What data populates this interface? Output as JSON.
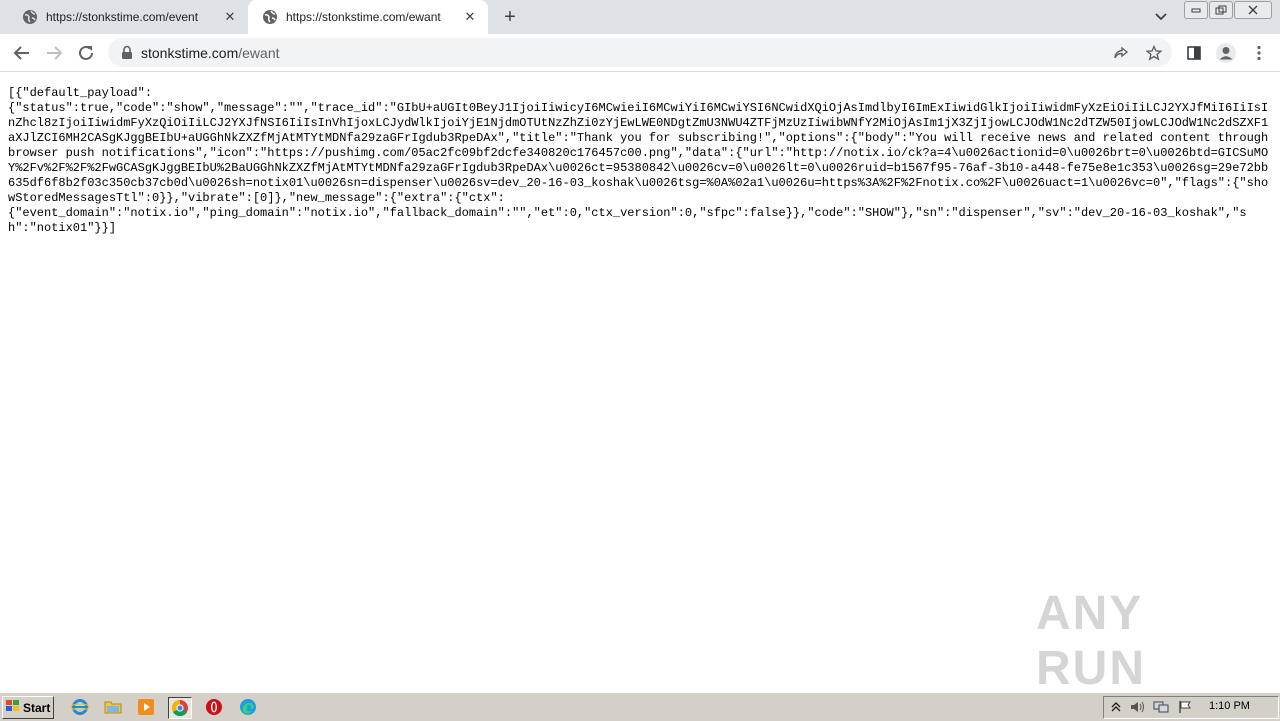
{
  "browser": {
    "tabs": [
      {
        "title": "https://stonkstime.com/event",
        "active": false
      },
      {
        "title": "https://stonkstime.com/ewant",
        "active": true
      }
    ],
    "address_bar": {
      "host": "stonkstime.com",
      "path": "/ewant"
    },
    "icons": {
      "favicon": "globe-icon",
      "close": "close-icon",
      "new_tab": "plus-icon",
      "tab_search": "chevron-down-icon",
      "back": "arrow-left-icon",
      "forward": "arrow-right-icon",
      "reload": "reload-icon",
      "lock": "lock-icon",
      "share": "share-icon",
      "bookmark": "star-icon",
      "side_panel": "side-panel-icon",
      "profile": "profile-icon",
      "menu": "kebab-menu-icon"
    }
  },
  "page": {
    "json_body": "[{\"default_payload\":\n{\"status\":true,\"code\":\"show\",\"message\":\"\",\"trace_id\":\"GIbU+aUGIt0BeyJ1IjoiIiwicyI6MCwieiI6MCwiYiI6MCwiYSI6NCwidXQiOjAsImdlbyI6ImExIiwidGlkIjoiIiwidmFyXzEiOiIiLCJ2YXJfMiI6IiIsInZhcl8zIjoiIiwidmFyXzQiOiIiLCJ2YXJfNSI6IiIsInVhIjoxLCJydWlkIjoiYjE1NjdmOTUtNzZhZi0zYjEwLWE0NDgtZmU3NWU4ZTFjMzUzIiwibWNfY2MiOjAsIm1jX3ZjIjowLCJOdW1Nc2dTZW50IjowLCJOdW1Nc2dSZXF1aXJlZCI6MH2CASgKJggBEIbU+aUGGhNkZXZfMjAtMTYtMDNfa29zaGFrIgdub3RpeDAx\",\"title\":\"Thank you for subscribing!\",\"options\":{\"body\":\"You will receive news and related content through browser push notifications\",\"icon\":\"https://pushimg.com/05ac2fc09bf2dcfe340820c176457c00.png\",\"data\":{\"url\":\"http://notix.io/ck?a=4\\u0026actionid=0\\u0026brt=0\\u0026btd=GICSuMOY%2Fv%2F%2F%2FwGCASgKJggBEIbU%2BaUGGhNkZXZfMjAtMTYtMDNfa29zaGFrIgdub3RpeDAx\\u0026ct=95380842\\u0026cv=0\\u0026lt=0\\u0026ruid=b1567f95-76af-3b10-a448-fe75e8e1c353\\u0026sg=29e72bb635df6f8b2f03c350cb37cb0d\\u0026sh=notix01\\u0026sn=dispenser\\u0026sv=dev_20-16-03_koshak\\u0026tsg=%0A%02a1\\u0026u=https%3A%2F%2Fnotix.co%2F\\u0026uact=1\\u0026vc=0\",\"flags\":{\"showStoredMessagesTtl\":0}},\"vibrate\":[0]},\"new_message\":{\"extra\":{\"ctx\":\n{\"event_domain\":\"notix.io\",\"ping_domain\":\"notix.io\",\"fallback_domain\":\"\",\"et\":0,\"ctx_version\":0,\"sfpc\":false}},\"code\":\"SHOW\"},\"sn\":\"dispenser\",\"sv\":\"dev_20-16-03_koshak\",\"sh\":\"notix01\"}}]",
    "watermark": "ANY RUN"
  },
  "taskbar": {
    "start_label": "Start",
    "apps": [
      "internet-explorer-icon",
      "file-explorer-icon",
      "media-player-icon",
      "chrome-icon",
      "opera-icon",
      "edge-icon"
    ],
    "clock": "1:10 PM"
  }
}
